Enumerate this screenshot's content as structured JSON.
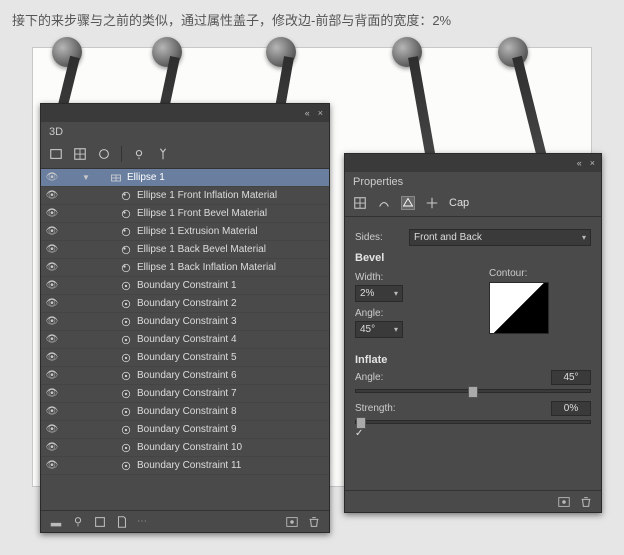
{
  "caption": "接下的来步骤与之前的类似，通过属性盖子，修改边-前部与背面的宽度：2%",
  "panels": {
    "threeD": {
      "title": "3D",
      "layers": [
        {
          "label": "Ellipse 1",
          "depth": 1,
          "icon": "mesh",
          "selected": true,
          "twisty": "▼"
        },
        {
          "label": "Ellipse 1 Front Inflation Material",
          "depth": 2,
          "icon": "material"
        },
        {
          "label": "Ellipse 1 Front Bevel Material",
          "depth": 2,
          "icon": "material"
        },
        {
          "label": "Ellipse 1 Extrusion Material",
          "depth": 2,
          "icon": "material"
        },
        {
          "label": "Ellipse 1 Back Bevel Material",
          "depth": 2,
          "icon": "material"
        },
        {
          "label": "Ellipse 1 Back Inflation Material",
          "depth": 2,
          "icon": "material"
        },
        {
          "label": "Boundary Constraint 1",
          "depth": 2,
          "icon": "constraint"
        },
        {
          "label": "Boundary Constraint 2",
          "depth": 2,
          "icon": "constraint"
        },
        {
          "label": "Boundary Constraint 3",
          "depth": 2,
          "icon": "constraint"
        },
        {
          "label": "Boundary Constraint 4",
          "depth": 2,
          "icon": "constraint"
        },
        {
          "label": "Boundary Constraint 5",
          "depth": 2,
          "icon": "constraint"
        },
        {
          "label": "Boundary Constraint 6",
          "depth": 2,
          "icon": "constraint"
        },
        {
          "label": "Boundary Constraint 7",
          "depth": 2,
          "icon": "constraint"
        },
        {
          "label": "Boundary Constraint 8",
          "depth": 2,
          "icon": "constraint"
        },
        {
          "label": "Boundary Constraint 9",
          "depth": 2,
          "icon": "constraint"
        },
        {
          "label": "Boundary Constraint 10",
          "depth": 2,
          "icon": "constraint"
        },
        {
          "label": "Boundary Constraint 11",
          "depth": 2,
          "icon": "constraint"
        }
      ]
    },
    "properties": {
      "title": "Properties",
      "cap_label": "Cap",
      "sides": {
        "label": "Sides:",
        "value": "Front and Back"
      },
      "bevel": {
        "heading": "Bevel",
        "width_label": "Width:",
        "width_value": "2%",
        "contour_label": "Contour:",
        "angle_label": "Angle:",
        "angle_value": "45°"
      },
      "inflate": {
        "heading": "Inflate",
        "angle_label": "Angle:",
        "angle_value": "45°",
        "strength_label": "Strength:",
        "strength_value": "0%"
      }
    }
  }
}
